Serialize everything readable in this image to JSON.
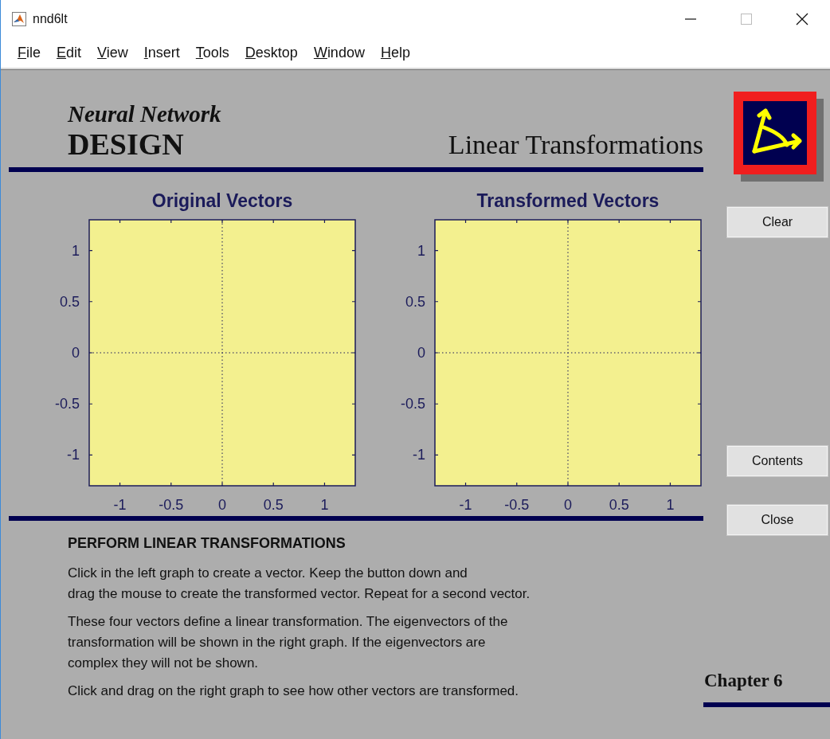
{
  "window": {
    "title": "nnd6lt"
  },
  "menu": [
    "File",
    "Edit",
    "View",
    "Insert",
    "Tools",
    "Desktop",
    "Window",
    "Help"
  ],
  "header": {
    "series": "Neural Network",
    "brand": "DESIGN",
    "title": "Linear Transformations"
  },
  "plots": [
    {
      "chart_data": {
        "type": "line",
        "title": "Original Vectors",
        "xlim": [
          -1.3,
          1.3
        ],
        "ylim": [
          -1.3,
          1.3
        ],
        "xticks": [
          -1,
          -0.5,
          0,
          0.5,
          1
        ],
        "yticks": [
          -1,
          -0.5,
          0,
          0.5,
          1
        ]
      }
    },
    {
      "chart_data": {
        "type": "line",
        "title": "Transformed Vectors",
        "xlim": [
          -1.3,
          1.3
        ],
        "ylim": [
          -1.3,
          1.3
        ],
        "xticks": [
          -1,
          -0.5,
          0,
          0.5,
          1
        ],
        "yticks": [
          -1,
          -0.5,
          0,
          0.5,
          1
        ]
      }
    }
  ],
  "buttons": [
    "Clear",
    "Contents",
    "Close"
  ],
  "instructions": {
    "heading": "PERFORM LINEAR TRANSFORMATIONS",
    "paragraphs": [
      [
        "Click in the left graph to create a vector. Keep the button down and",
        "drag the mouse to create the transformed vector. Repeat for a second vector."
      ],
      [
        "These four vectors define a linear transformation. The eigenvectors of the",
        "transformation will be shown in the right graph. If the eigenvectors are",
        "complex they will not be shown."
      ],
      [
        "Click and drag on the right graph to see how other vectors are transformed."
      ]
    ]
  },
  "chapter": "Chapter 6"
}
